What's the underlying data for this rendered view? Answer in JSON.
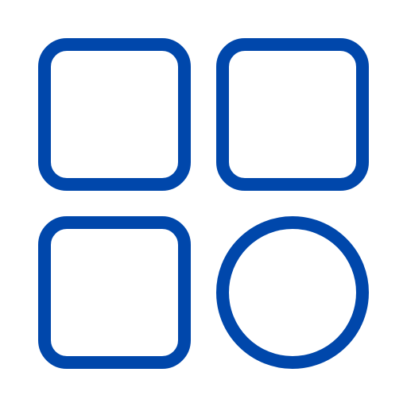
{
  "icon": {
    "name": "grid-apps-icon",
    "tiles": [
      {
        "name": "rounded-square-top-left",
        "shape": "rounded-square"
      },
      {
        "name": "rounded-square-top-right",
        "shape": "rounded-square"
      },
      {
        "name": "rounded-square-bottom-left",
        "shape": "rounded-square"
      },
      {
        "name": "circle-bottom-right",
        "shape": "circle"
      }
    ],
    "colors": {
      "stroke": "#0047AB",
      "background": "#FFFFFF"
    }
  }
}
